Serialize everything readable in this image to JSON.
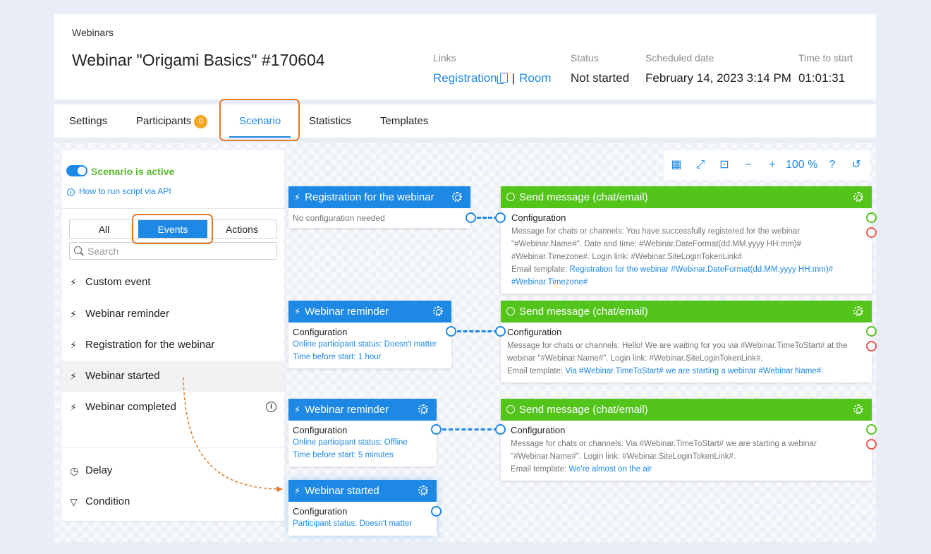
{
  "header": {
    "breadcrumb": "Webinars",
    "title": "Webinar \"Origami Basics\" #170604",
    "links_label": "Links",
    "registration_link": "Registration",
    "link_separator": "|",
    "room_link": "Room",
    "status_label": "Status",
    "status_value": "Not started",
    "scheduled_label": "Scheduled date",
    "scheduled_value": "February 14, 2023 3:14 PM",
    "time_label": "Time to start",
    "time_value": "01:01:31"
  },
  "tabs": [
    {
      "label": "Settings"
    },
    {
      "label": "Participants",
      "badge": "0"
    },
    {
      "label": "Scenario",
      "active": true
    },
    {
      "label": "Statistics"
    },
    {
      "label": "Templates"
    }
  ],
  "panel": {
    "toggle_label": "Scenario is active",
    "api_link": "How to run script via API",
    "segments": [
      "All",
      "Events",
      "Actions"
    ],
    "selected_segment": "Events",
    "search_placeholder": "Search",
    "events": [
      "Custom event",
      "Webinar reminder",
      "Registration for the webinar",
      "Webinar started",
      "Webinar completed"
    ],
    "actions": [
      "Delay",
      "Condition"
    ]
  },
  "zoom": {
    "value": "100 %",
    "tools": [
      "grid-icon",
      "fullscreen-icon",
      "fit-icon",
      "zoom-out-icon",
      "zoom-in-icon",
      "help-icon",
      "history-icon"
    ]
  },
  "nodes": {
    "registration": {
      "title": "Registration for the webinar",
      "body": "No configuration needed"
    },
    "reminder1": {
      "title": "Webinar reminder",
      "config": "Configuration",
      "line1": "Online participant status: Doesn't matter",
      "line2": "Time before start: 1 hour"
    },
    "reminder2": {
      "title": "Webinar reminder",
      "config": "Configuration",
      "line1": "Online participant status: Offline",
      "line2": "Time before start: 5 minutes"
    },
    "started": {
      "title": "Webinar started",
      "config": "Configuration",
      "line1": "Participant status: Doesn't matter"
    },
    "msg1": {
      "title": "Send message (chat/email)",
      "config": "Configuration",
      "text": "Message for chats or channels: You have successfully registered for the webinar \"#Webinar.Name#\". Date and time: #Webinar.DateFormat(dd.MM.yyyy HH:mm)# #Webinar.Timezone#. Login link: #Webinar.SiteLoginTokenLink#",
      "email_label": "Email template: ",
      "email_link": "Registration for the webinar #Webinar.DateFormat(dd.MM.yyyy HH:mm)# #Webinar.Timezone#"
    },
    "msg2": {
      "title": "Send message (chat/email)",
      "config": "Configuration",
      "text": "Message for chats or channels: Hello! We are waiting for you via #Webinar.TimeToStart# at the webinar \"#Webinar.Name#\". Login link: #Webinar.SiteLoginTokenLink#.",
      "email_label": "Email template: ",
      "email_link": "Via #Webinar.TimeToStart# we are starting a webinar #Webinar.Name#."
    },
    "msg3": {
      "title": "Send message (chat/email)",
      "config": "Configuration",
      "text": "Message for chats or channels: Via #Webinar.TimeToStart# we are starting a webinar \"#Webinar.Name#\". Login link: #Webinar.SiteLoginTokenLink#.",
      "email_label": "Email template: ",
      "email_link": "We're almost on the air"
    }
  },
  "colors": {
    "accent": "#1e88e5",
    "active_green": "#52c41a",
    "highlight_orange": "#e07b2a",
    "badge_orange": "#f5a623",
    "error_red": "#ef5350"
  }
}
